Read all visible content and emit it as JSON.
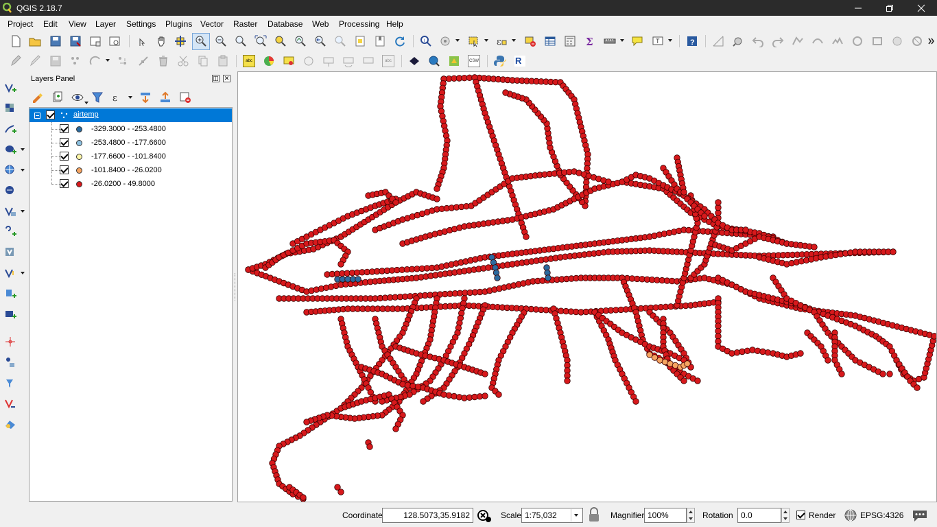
{
  "window": {
    "title": "QGIS 2.18.7"
  },
  "menu": [
    "Project",
    "Edit",
    "View",
    "Layer",
    "Settings",
    "Plugins",
    "Vector",
    "Raster",
    "Database",
    "Web",
    "Processing",
    "Help"
  ],
  "toolbar": {
    "labels": [
      "abc",
      "abc",
      "CSW"
    ]
  },
  "layers_panel": {
    "title": "Layers Panel",
    "layer": {
      "name": "airtemp",
      "visible": true,
      "classes": [
        {
          "label": "-329.3000 - -253.4800",
          "color": "#2b6a9e",
          "checked": true
        },
        {
          "label": "-253.4800 - -177.6600",
          "color": "#8cc0e0",
          "checked": true
        },
        {
          "label": "-177.6600 - -101.8400",
          "color": "#fef7a8",
          "checked": true
        },
        {
          "label": "-101.8400 - -26.0200",
          "color": "#f6a461",
          "checked": true
        },
        {
          "label": "-26.0200 - 49.8000",
          "color": "#d7191c",
          "checked": true
        }
      ]
    }
  },
  "map": {
    "point_fill": "#d7191c",
    "point_stroke": "#3a0000",
    "accent_low": "#2b6a9e",
    "accent_mid": "#f6a461"
  },
  "status": {
    "coordinate_label": "Coordinate",
    "coordinate_value": "128.5073,35.9182",
    "scale_label": "Scale",
    "scale_value": "1:75,032",
    "magnifier_label": "Magnifier",
    "magnifier_value": "100%",
    "rotation_label": "Rotation",
    "rotation_value": "0.0",
    "render_label": "Render",
    "render_checked": true,
    "crs": "EPSG:4326"
  }
}
